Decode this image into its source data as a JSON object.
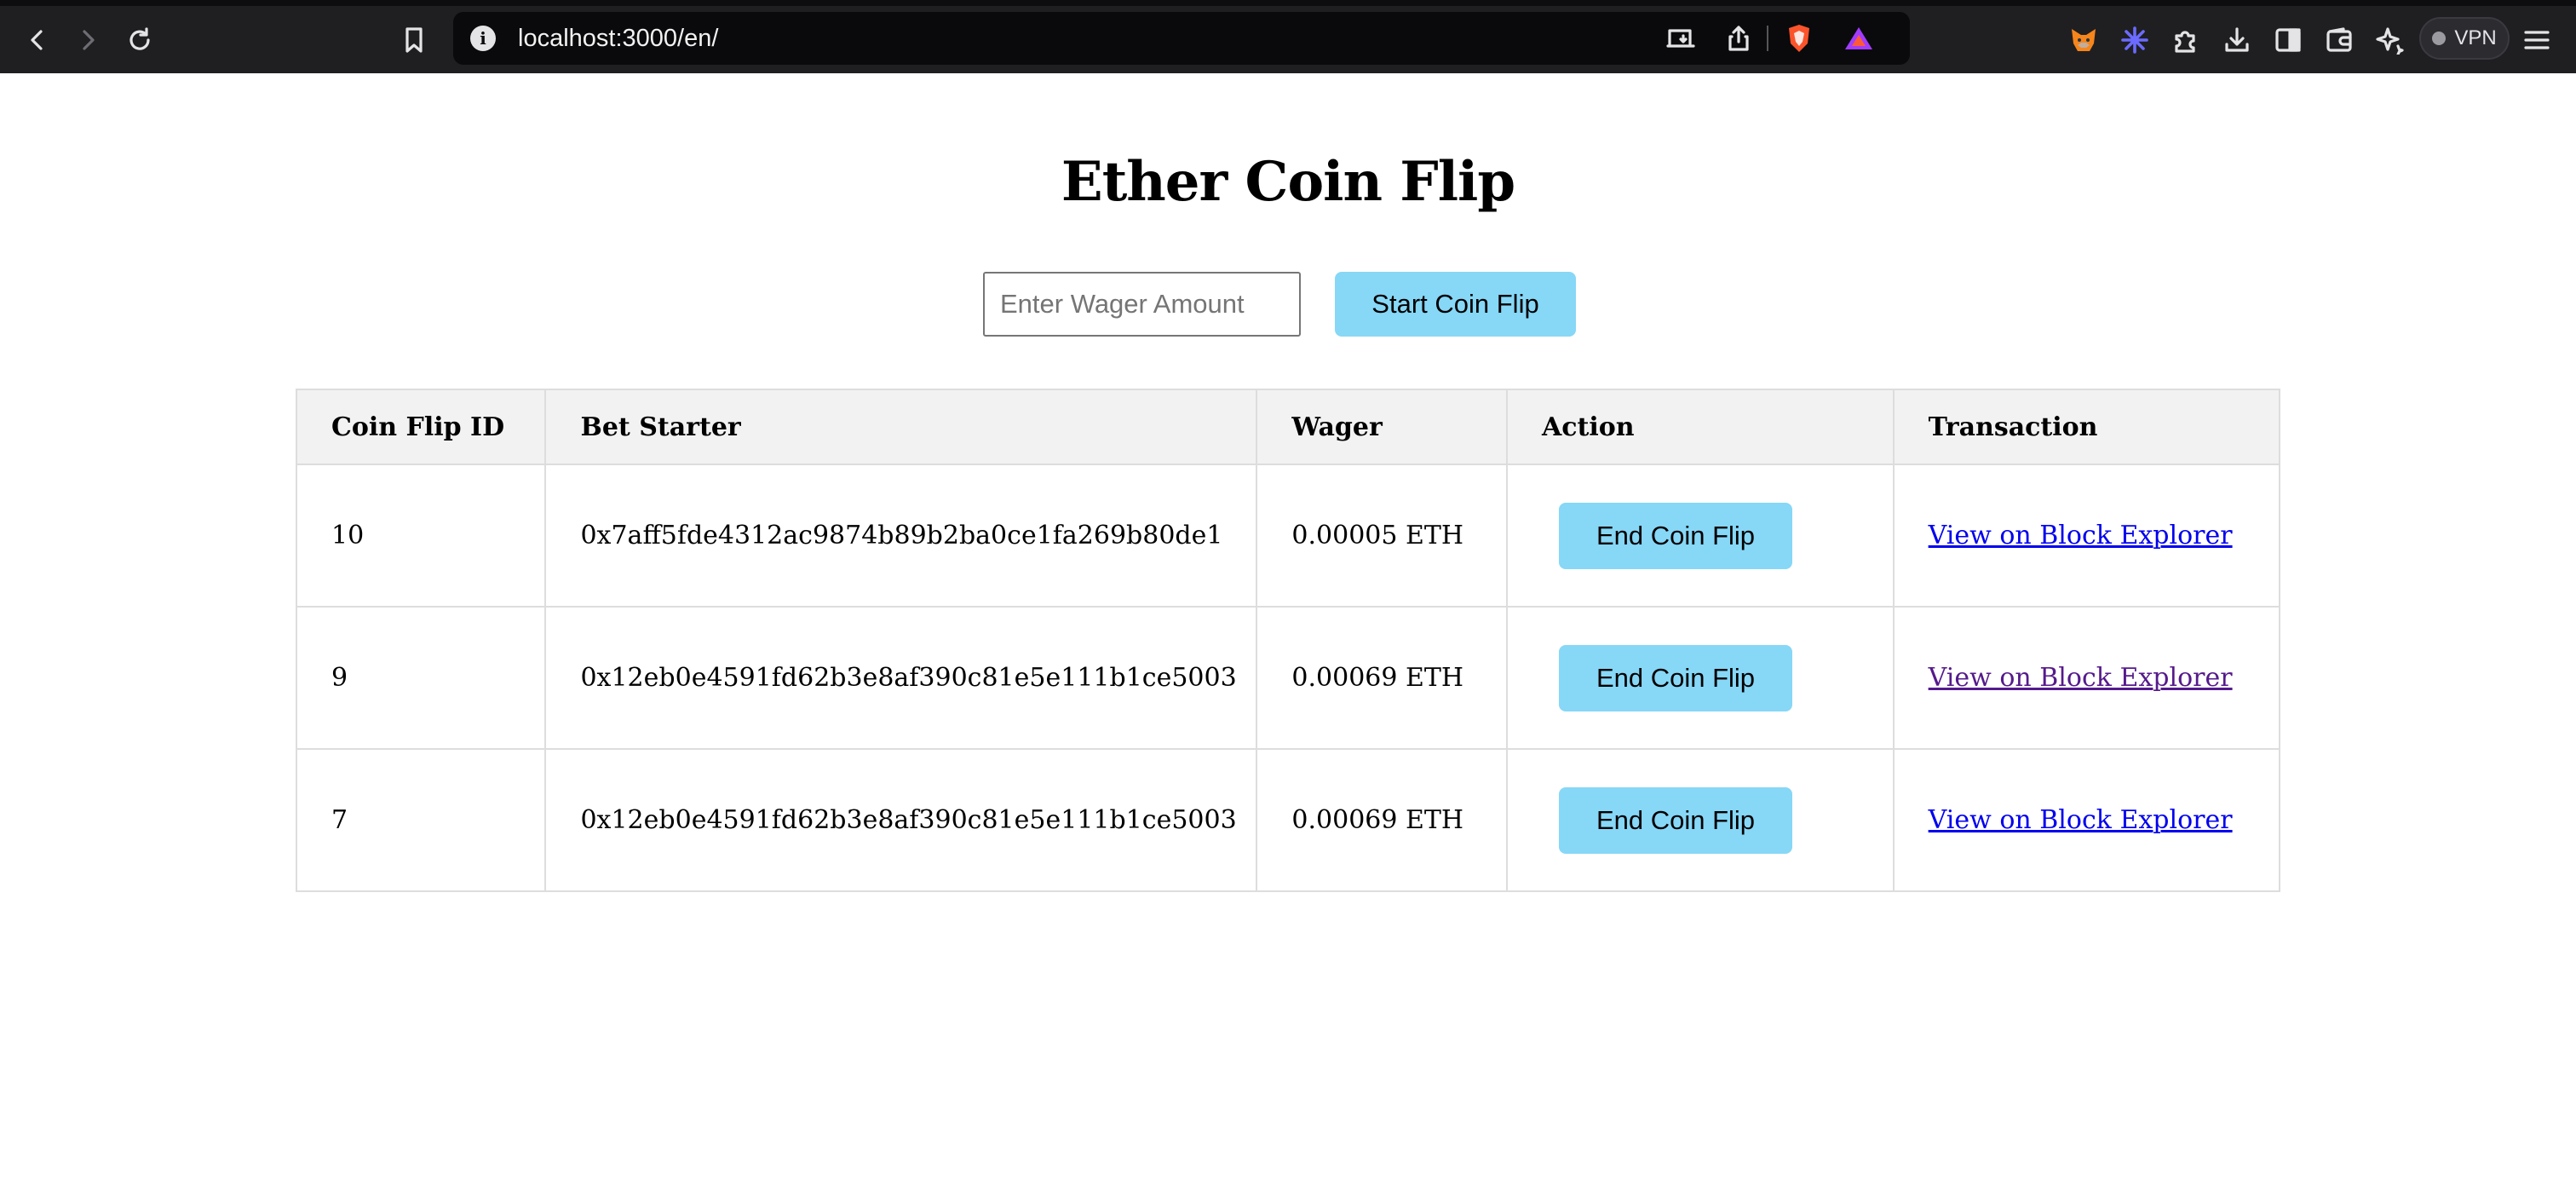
{
  "browser": {
    "url": "localhost:3000/en/",
    "vpn_label": "VPN"
  },
  "page": {
    "title": "Ether Coin Flip",
    "wager_placeholder": "Enter Wager Amount",
    "start_button": "Start Coin Flip"
  },
  "table": {
    "headers": [
      "Coin Flip ID",
      "Bet Starter",
      "Wager",
      "Action",
      "Transaction"
    ],
    "rows": [
      {
        "id": "10",
        "starter": "0x7aff5fde4312ac9874b89b2ba0ce1fa269b80de1",
        "wager": "0.00005 ETH",
        "action": "End Coin Flip",
        "link": "View on Block Explorer",
        "visited": false
      },
      {
        "id": "9",
        "starter": "0x12eb0e4591fd62b3e8af390c81e5e111b1ce5003",
        "wager": "0.00069 ETH",
        "action": "End Coin Flip",
        "link": "View on Block Explorer",
        "visited": true
      },
      {
        "id": "7",
        "starter": "0x12eb0e4591fd62b3e8af390c81e5e111b1ce5003",
        "wager": "0.00069 ETH",
        "action": "End Coin Flip",
        "link": "View on Block Explorer",
        "visited": false
      }
    ]
  },
  "colors": {
    "button_bg": "#87d7f7",
    "link": "#0000ee",
    "link_visited": "#551a8b",
    "header_bg": "#f2f2f2"
  },
  "icons": [
    "back-icon",
    "forward-icon",
    "reload-icon",
    "bookmark-icon",
    "info-icon",
    "cast-icon",
    "share-icon",
    "brave-shields-icon",
    "brave-rewards-icon",
    "metamask-icon",
    "leo-icon",
    "extensions-icon",
    "downloads-icon",
    "sidebar-icon",
    "wallet-icon",
    "ai-sparkle-icon",
    "menu-icon"
  ]
}
